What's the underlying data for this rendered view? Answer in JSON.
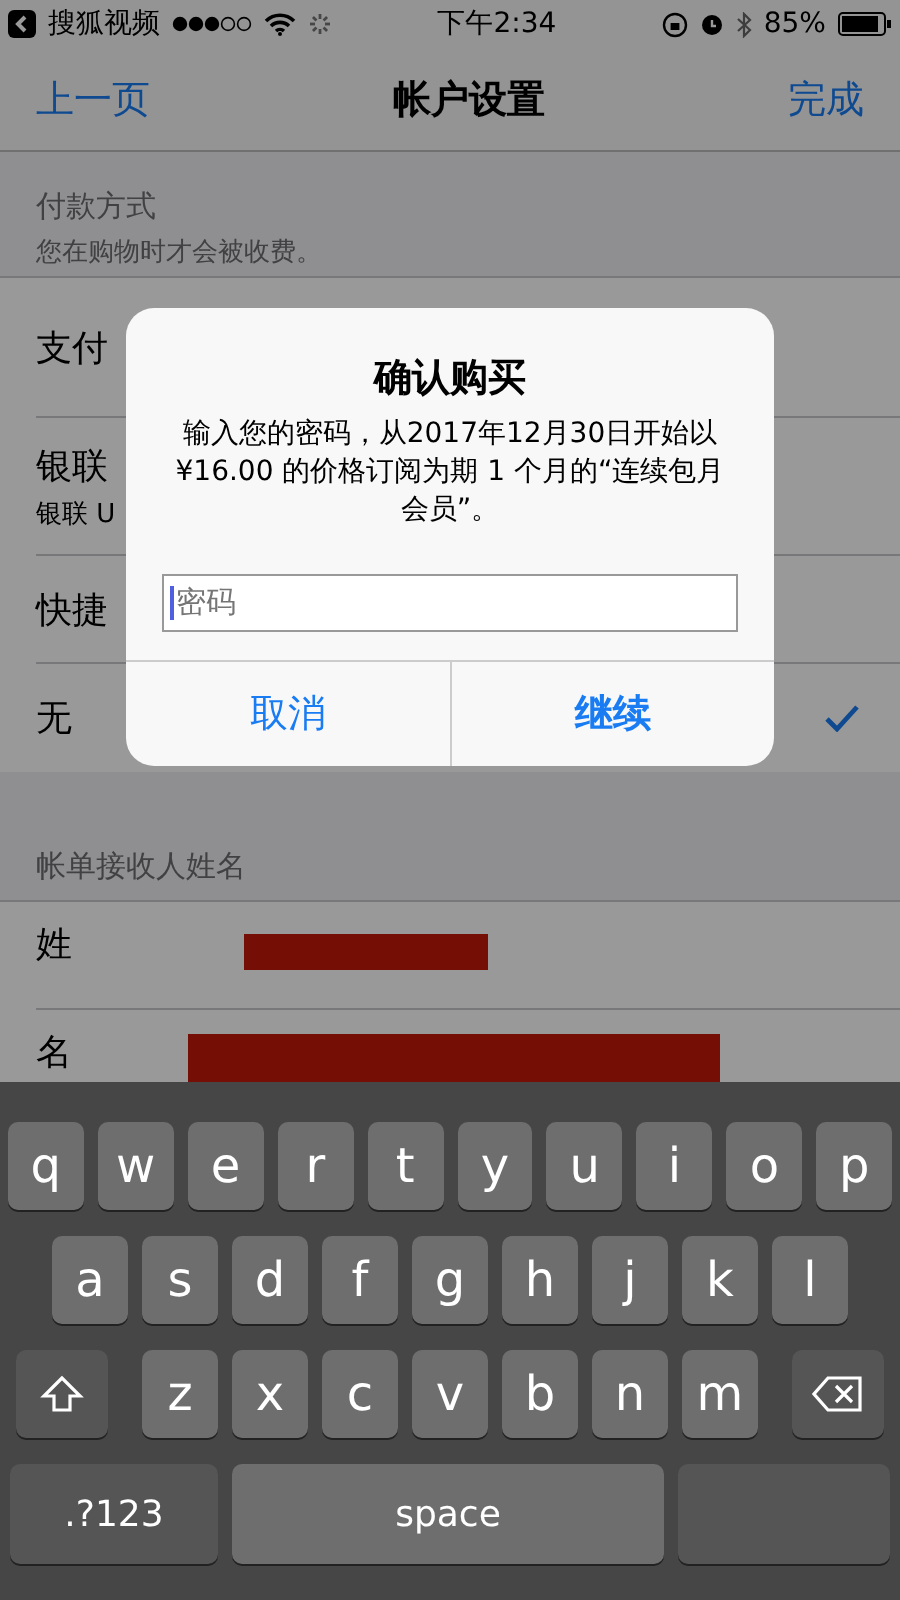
{
  "status_bar": {
    "back_app": "搜狐视频",
    "time": "下午2:34",
    "battery": "85%"
  },
  "nav": {
    "back": "上一页",
    "title": "帐户设置",
    "done": "完成"
  },
  "payment_section": {
    "title": "付款方式",
    "note": "您在购物时才会被收费。",
    "options": [
      {
        "label": "支付",
        "selected": false
      },
      {
        "label": "银联",
        "sublabel": "银联 U",
        "selected": false
      },
      {
        "label": "快捷",
        "selected": false
      },
      {
        "label": "无",
        "selected": true
      }
    ]
  },
  "billing_section": {
    "title": "帐单接收人姓名",
    "fields": [
      {
        "label": "姓"
      },
      {
        "label": "名"
      }
    ]
  },
  "dialog": {
    "title": "确认购买",
    "message": "输入您的密码，从2017年12月30日开始以 ¥16.00 的价格订阅为期 1 个月的“连续包月会员”。",
    "password": {
      "placeholder": "密码"
    },
    "buttons": [
      {
        "label": "取消",
        "kind": "cancel"
      },
      {
        "label": "继续",
        "kind": "default"
      }
    ]
  },
  "keyboard": {
    "rows": [
      {
        "keys": [
          {
            "kind": "letter",
            "label": "q"
          },
          {
            "kind": "letter",
            "label": "w"
          },
          {
            "kind": "letter",
            "label": "e"
          },
          {
            "kind": "letter",
            "label": "r"
          },
          {
            "kind": "letter",
            "label": "t"
          },
          {
            "kind": "letter",
            "label": "y"
          },
          {
            "kind": "letter",
            "label": "u"
          },
          {
            "kind": "letter",
            "label": "i"
          },
          {
            "kind": "letter",
            "label": "o"
          },
          {
            "kind": "letter",
            "label": "p"
          }
        ]
      },
      {
        "keys": [
          {
            "kind": "letter",
            "label": "a"
          },
          {
            "kind": "letter",
            "label": "s"
          },
          {
            "kind": "letter",
            "label": "d"
          },
          {
            "kind": "letter",
            "label": "f"
          },
          {
            "kind": "letter",
            "label": "g"
          },
          {
            "kind": "letter",
            "label": "h"
          },
          {
            "kind": "letter",
            "label": "j"
          },
          {
            "kind": "letter",
            "label": "k"
          },
          {
            "kind": "letter",
            "label": "l"
          }
        ]
      },
      {
        "keys": [
          {
            "kind": "shift"
          },
          {
            "kind": "letter",
            "label": "z"
          },
          {
            "kind": "letter",
            "label": "x"
          },
          {
            "kind": "letter",
            "label": "c"
          },
          {
            "kind": "letter",
            "label": "v"
          },
          {
            "kind": "letter",
            "label": "b"
          },
          {
            "kind": "letter",
            "label": "n"
          },
          {
            "kind": "letter",
            "label": "m"
          },
          {
            "kind": "delete"
          }
        ]
      },
      {
        "keys": [
          {
            "kind": "mode",
            "label": ".?123"
          },
          {
            "kind": "space",
            "label": "space"
          },
          {
            "kind": "return"
          }
        ]
      }
    ]
  }
}
